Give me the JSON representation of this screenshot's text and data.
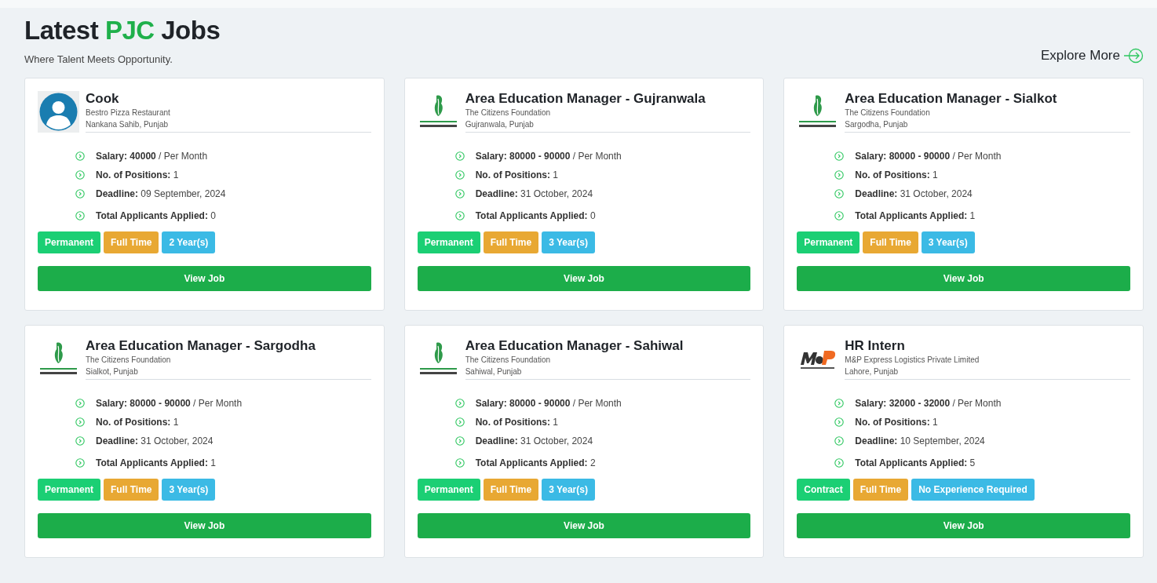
{
  "header": {
    "title_start": "Latest",
    "title_highlight": "PJC",
    "title_end": "Jobs",
    "subtitle": "Where Talent Meets Opportunity.",
    "explore_link": "Explore More"
  },
  "jobs": [
    {
      "logo": {
        "kind": "avatar"
      },
      "title": "Cook",
      "company": "Bestro Pizza Restaurant",
      "location": "Nankana Sahib, Punjab",
      "details": [
        "**Salary: 40000** / Per Month",
        "**No. of Positions:** 1",
        "**Deadline:** 09 September, 2024",
        "**Total Applicants Applied:** 0"
      ],
      "tags": [
        {
          "kind": "type",
          "label": "Permanent"
        },
        {
          "kind": "schedule",
          "label": "Full Time"
        },
        {
          "kind": "experience",
          "label": "2 Year(s)"
        }
      ],
      "button": "View Job"
    },
    {
      "logo": {
        "kind": "foundation"
      },
      "title": "Area Education Manager - Gujranwala",
      "company": "The Citizens Foundation",
      "location": "Gujranwala, Punjab",
      "details": [
        "**Salary: 80000 - 90000** / Per Month",
        "**No. of Positions:** 1",
        "**Deadline:** 31 October, 2024",
        "**Total Applicants Applied:** 0"
      ],
      "tags": [
        {
          "kind": "type",
          "label": "Permanent"
        },
        {
          "kind": "schedule",
          "label": "Full Time"
        },
        {
          "kind": "experience",
          "label": "3 Year(s)"
        }
      ],
      "button": "View Job"
    },
    {
      "logo": {
        "kind": "foundation"
      },
      "title": "Area Education Manager - Sialkot",
      "company": "The Citizens Foundation",
      "location": "Sargodha, Punjab",
      "details": [
        "**Salary: 80000 - 90000** / Per Month",
        "**No. of Positions:** 1",
        "**Deadline:** 31 October, 2024",
        "**Total Applicants Applied:** 1"
      ],
      "tags": [
        {
          "kind": "type",
          "label": "Permanent"
        },
        {
          "kind": "schedule",
          "label": "Full Time"
        },
        {
          "kind": "experience",
          "label": "3 Year(s)"
        }
      ],
      "button": "View Job"
    },
    {
      "logo": {
        "kind": "foundation"
      },
      "title": "Area Education Manager - Sargodha",
      "company": "The Citizens Foundation",
      "location": "Sialkot, Punjab",
      "details": [
        "**Salary: 80000 - 90000** / Per Month",
        "**No. of Positions:** 1",
        "**Deadline:** 31 October, 2024",
        "**Total Applicants Applied:** 1"
      ],
      "tags": [
        {
          "kind": "type",
          "label": "Permanent"
        },
        {
          "kind": "schedule",
          "label": "Full Time"
        },
        {
          "kind": "experience",
          "label": "3 Year(s)"
        }
      ],
      "button": "View Job"
    },
    {
      "logo": {
        "kind": "foundation"
      },
      "title": "Area Education Manager - Sahiwal",
      "company": "The Citizens Foundation",
      "location": "Sahiwal, Punjab",
      "details": [
        "**Salary: 80000 - 90000** / Per Month",
        "**No. of Positions:** 1",
        "**Deadline:** 31 October, 2024",
        "**Total Applicants Applied:** 2"
      ],
      "tags": [
        {
          "kind": "type",
          "label": "Permanent"
        },
        {
          "kind": "schedule",
          "label": "Full Time"
        },
        {
          "kind": "experience",
          "label": "3 Year(s)"
        }
      ],
      "button": "View Job"
    },
    {
      "logo": {
        "kind": "logistics"
      },
      "title": "HR Intern",
      "company": "M&P Express Logistics Private Limited",
      "location": "Lahore, Punjab",
      "details": [
        "**Salary: 32000 - 32000** / Per Month",
        "**No. of Positions:** 1",
        "**Deadline:** 10 September, 2024",
        "**Total Applicants Applied:** 5"
      ],
      "tags": [
        {
          "kind": "type",
          "label": "Contract"
        },
        {
          "kind": "schedule",
          "label": "Full Time"
        },
        {
          "kind": "experience",
          "label": "No Experience Required"
        }
      ],
      "button": "View Job"
    }
  ]
}
